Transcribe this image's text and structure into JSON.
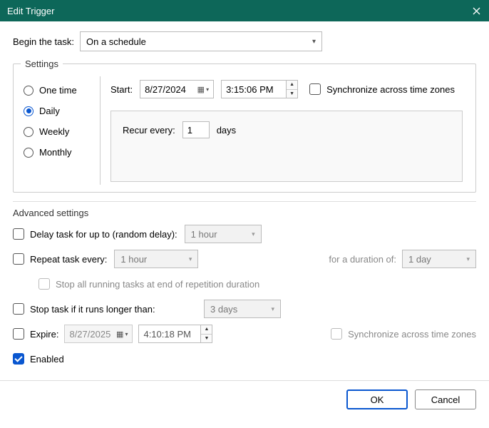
{
  "title": "Edit Trigger",
  "begin": {
    "label": "Begin the task:",
    "value": "On a schedule"
  },
  "settings": {
    "legend": "Settings",
    "radios": {
      "one_time": "One time",
      "daily": "Daily",
      "weekly": "Weekly",
      "monthly": "Monthly",
      "selected": "daily"
    },
    "start_label": "Start:",
    "start_date": "8/27/2024",
    "start_time": "3:15:06 PM",
    "sync_tz": "Synchronize across time zones",
    "recur_label": "Recur every:",
    "recur_value": "1",
    "recur_unit": "days"
  },
  "advanced": {
    "legend": "Advanced settings",
    "delay": {
      "label": "Delay task for up to (random delay):",
      "value": "1 hour"
    },
    "repeat": {
      "label": "Repeat task every:",
      "value": "1 hour",
      "duration_label": "for a duration of:",
      "duration_value": "1 day"
    },
    "stop_all": "Stop all running tasks at end of repetition duration",
    "stop_long": {
      "label": "Stop task if it runs longer than:",
      "value": "3 days"
    },
    "expire": {
      "label": "Expire:",
      "date": "8/27/2025",
      "time": "4:10:18 PM",
      "sync_tz": "Synchronize across time zones"
    },
    "enabled": "Enabled"
  },
  "buttons": {
    "ok": "OK",
    "cancel": "Cancel"
  }
}
